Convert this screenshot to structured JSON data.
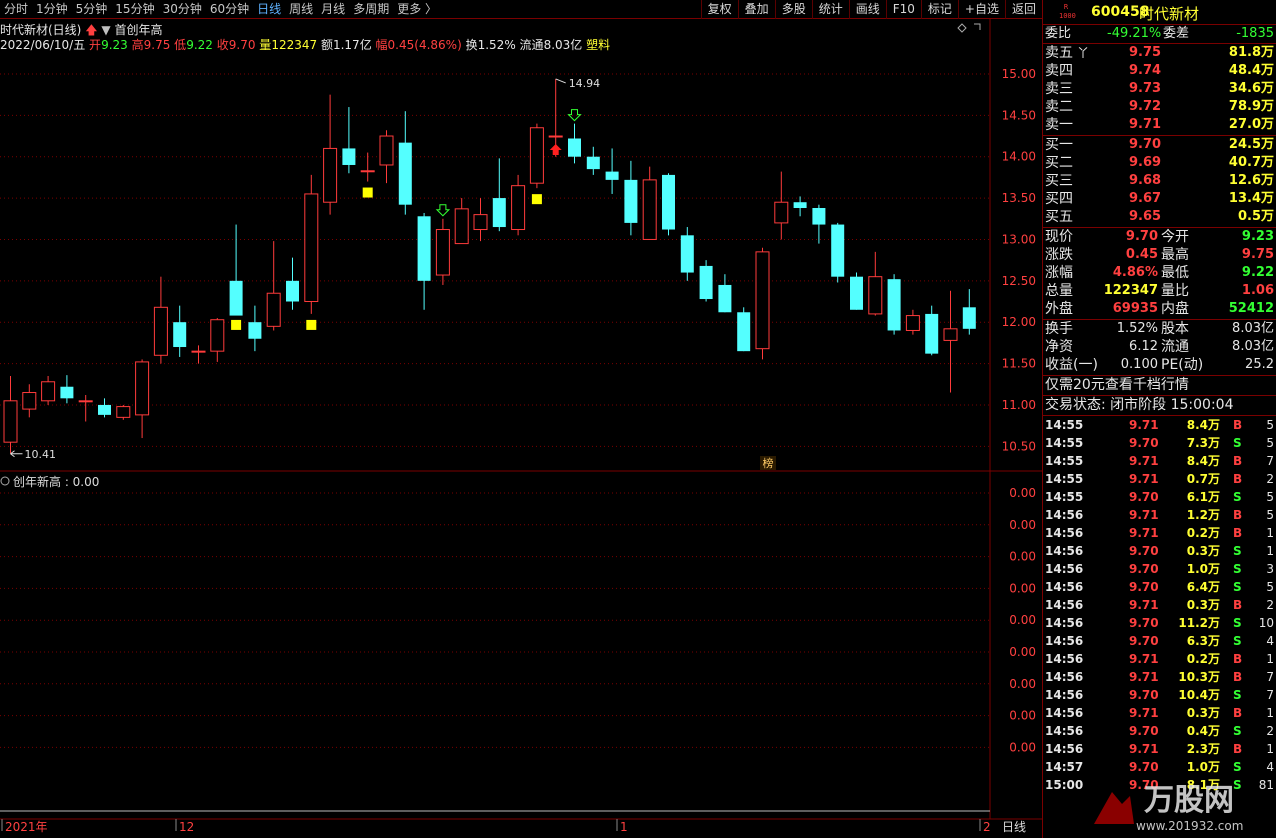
{
  "toolbar": {
    "periods": [
      "分时",
      "1分钟",
      "5分钟",
      "15分钟",
      "30分钟",
      "60分钟",
      "日线",
      "周线",
      "月线",
      "多周期",
      "更多 〉"
    ],
    "active_period": "日线",
    "tools": [
      "复权",
      "叠加",
      "多股",
      "统计",
      "画线",
      "F10",
      "标记",
      "+自选",
      "返回"
    ]
  },
  "chart_header": {
    "title": "时代新材(日线)",
    "indicator": "首创年高",
    "date": "2022/06/10/五",
    "open_label": "开",
    "open": "9.23",
    "high_label": "高",
    "high": "9.75",
    "low_label": "低",
    "low": "9.22",
    "close_label": "收",
    "close": "9.70",
    "volume_label": "量",
    "volume": "122347",
    "amount_label": "额",
    "amount": "1.17亿",
    "range_label": "幅",
    "range": "0.45(4.86%)",
    "turnover_label": "换",
    "turnover": "1.52%",
    "float_label": "流通",
    "float": "8.03亿",
    "sector": "塑料"
  },
  "sub_chart": {
    "title": "创年新高 : 0.00",
    "ticks": [
      "0.00",
      "0.00",
      "0.00",
      "0.00",
      "0.00",
      "0.00",
      "0.00",
      "0.00",
      "0.00"
    ]
  },
  "bottom_axis": {
    "labels": [
      "2021年",
      "12",
      "1",
      "2"
    ],
    "period_label": "日线"
  },
  "badge": "榜",
  "chart_data": {
    "type": "candlestick",
    "y_ticks": [
      "15.00",
      "14.50",
      "14.00",
      "13.50",
      "13.00",
      "12.50",
      "12.00",
      "11.50",
      "11.00",
      "10.50"
    ],
    "ylim": [
      10.25,
      15.35
    ],
    "max_label": "14.94",
    "min_label": "10.41",
    "candles": [
      {
        "o": 10.55,
        "h": 11.35,
        "l": 10.41,
        "c": 11.05
      },
      {
        "o": 10.95,
        "h": 11.25,
        "l": 10.85,
        "c": 11.15
      },
      {
        "o": 11.05,
        "h": 11.35,
        "l": 11.0,
        "c": 11.28
      },
      {
        "o": 11.22,
        "h": 11.36,
        "l": 11.02,
        "c": 11.08
      },
      {
        "o": 11.05,
        "h": 11.12,
        "l": 10.8,
        "c": 11.05
      },
      {
        "o": 11.0,
        "h": 11.08,
        "l": 10.85,
        "c": 10.88
      },
      {
        "o": 10.85,
        "h": 11.0,
        "l": 10.82,
        "c": 10.98
      },
      {
        "o": 10.88,
        "h": 11.55,
        "l": 10.6,
        "c": 11.52
      },
      {
        "o": 11.6,
        "h": 12.55,
        "l": 11.5,
        "c": 12.18
      },
      {
        "o": 12.0,
        "h": 12.2,
        "l": 11.58,
        "c": 11.7
      },
      {
        "o": 11.65,
        "h": 11.72,
        "l": 11.5,
        "c": 11.65
      },
      {
        "o": 11.65,
        "h": 12.05,
        "l": 11.52,
        "c": 12.03
      },
      {
        "o": 12.5,
        "h": 13.18,
        "l": 12.1,
        "c": 12.08
      },
      {
        "o": 12.0,
        "h": 12.2,
        "l": 11.65,
        "c": 11.8
      },
      {
        "o": 11.95,
        "h": 12.98,
        "l": 11.9,
        "c": 12.35
      },
      {
        "o": 12.5,
        "h": 12.78,
        "l": 12.15,
        "c": 12.25
      },
      {
        "o": 12.25,
        "h": 13.78,
        "l": 12.1,
        "c": 13.55
      },
      {
        "o": 13.45,
        "h": 14.75,
        "l": 13.3,
        "c": 14.1
      },
      {
        "o": 14.1,
        "h": 14.6,
        "l": 13.8,
        "c": 13.9
      },
      {
        "o": 13.83,
        "h": 14.05,
        "l": 13.7,
        "c": 13.83
      },
      {
        "o": 13.9,
        "h": 14.32,
        "l": 13.68,
        "c": 14.25
      },
      {
        "o": 14.17,
        "h": 14.55,
        "l": 13.3,
        "c": 13.42
      },
      {
        "o": 13.28,
        "h": 13.32,
        "l": 12.15,
        "c": 12.5
      },
      {
        "o": 12.57,
        "h": 13.25,
        "l": 12.45,
        "c": 13.12
      },
      {
        "o": 12.95,
        "h": 13.5,
        "l": 12.95,
        "c": 13.37
      },
      {
        "o": 13.12,
        "h": 13.5,
        "l": 12.98,
        "c": 13.3
      },
      {
        "o": 13.5,
        "h": 13.98,
        "l": 13.1,
        "c": 13.15
      },
      {
        "o": 13.12,
        "h": 13.78,
        "l": 13.05,
        "c": 13.65
      },
      {
        "o": 13.68,
        "h": 14.4,
        "l": 13.62,
        "c": 14.35
      },
      {
        "o": 14.25,
        "h": 14.94,
        "l": 14.0,
        "c": 14.25
      },
      {
        "o": 14.22,
        "h": 14.4,
        "l": 13.92,
        "c": 14.0
      },
      {
        "o": 14.0,
        "h": 14.12,
        "l": 13.78,
        "c": 13.85
      },
      {
        "o": 13.82,
        "h": 14.1,
        "l": 13.55,
        "c": 13.72
      },
      {
        "o": 13.72,
        "h": 13.95,
        "l": 13.05,
        "c": 13.2
      },
      {
        "o": 13.0,
        "h": 13.88,
        "l": 13.0,
        "c": 13.72
      },
      {
        "o": 13.78,
        "h": 13.8,
        "l": 13.05,
        "c": 13.12
      },
      {
        "o": 13.05,
        "h": 13.15,
        "l": 12.5,
        "c": 12.6
      },
      {
        "o": 12.68,
        "h": 12.75,
        "l": 12.25,
        "c": 12.28
      },
      {
        "o": 12.45,
        "h": 12.58,
        "l": 12.12,
        "c": 12.12
      },
      {
        "o": 12.12,
        "h": 12.18,
        "l": 11.65,
        "c": 11.65
      },
      {
        "o": 11.68,
        "h": 12.9,
        "l": 11.55,
        "c": 12.85
      },
      {
        "o": 13.2,
        "h": 13.82,
        "l": 13.0,
        "c": 13.45
      },
      {
        "o": 13.45,
        "h": 13.52,
        "l": 13.28,
        "c": 13.38
      },
      {
        "o": 13.38,
        "h": 13.42,
        "l": 12.95,
        "c": 13.18
      },
      {
        "o": 13.18,
        "h": 13.2,
        "l": 12.48,
        "c": 12.55
      },
      {
        "o": 12.55,
        "h": 12.6,
        "l": 12.15,
        "c": 12.15
      },
      {
        "o": 12.1,
        "h": 12.85,
        "l": 12.08,
        "c": 12.55
      },
      {
        "o": 12.52,
        "h": 12.58,
        "l": 11.85,
        "c": 11.9
      },
      {
        "o": 11.9,
        "h": 12.15,
        "l": 11.85,
        "c": 12.08
      },
      {
        "o": 12.1,
        "h": 12.2,
        "l": 11.6,
        "c": 11.62
      },
      {
        "o": 11.78,
        "h": 12.38,
        "l": 11.15,
        "c": 11.92
      },
      {
        "o": 12.18,
        "h": 12.4,
        "l": 11.85,
        "c": 11.92
      }
    ],
    "yellow_markers": [
      12,
      16,
      19,
      28
    ],
    "down_arrows": [
      23,
      30
    ],
    "up_arrow": 29
  },
  "quote": {
    "code": "600458",
    "name": "时代新材",
    "r_badge": "R",
    "r_badge_num": "1000",
    "wei_bi_label": "委比",
    "wei_bi": "-49.21%",
    "wei_cha_label": "委差",
    "wei_cha": "-1835",
    "sell": [
      {
        "label": "卖五",
        "price": "9.75",
        "vol": "81.8万",
        "mark": "丫"
      },
      {
        "label": "卖四",
        "price": "9.74",
        "vol": "48.4万",
        "mark": ""
      },
      {
        "label": "卖三",
        "price": "9.73",
        "vol": "34.6万",
        "mark": ""
      },
      {
        "label": "卖二",
        "price": "9.72",
        "vol": "78.9万",
        "mark": ""
      },
      {
        "label": "卖一",
        "price": "9.71",
        "vol": "27.0万",
        "mark": ""
      }
    ],
    "buy": [
      {
        "label": "买一",
        "price": "9.70",
        "vol": "24.5万"
      },
      {
        "label": "买二",
        "price": "9.69",
        "vol": "40.7万"
      },
      {
        "label": "买三",
        "price": "9.68",
        "vol": "12.6万"
      },
      {
        "label": "买四",
        "price": "9.67",
        "vol": "13.4万"
      },
      {
        "label": "买五",
        "price": "9.65",
        "vol": "0.5万"
      }
    ],
    "stats": [
      {
        "l1": "现价",
        "v1": "9.70",
        "c1": "red",
        "l2": "今开",
        "v2": "9.23",
        "c2": "green"
      },
      {
        "l1": "涨跌",
        "v1": "0.45",
        "c1": "red",
        "l2": "最高",
        "v2": "9.75",
        "c2": "red"
      },
      {
        "l1": "涨幅",
        "v1": "4.86%",
        "c1": "red",
        "l2": "最低",
        "v2": "9.22",
        "c2": "green"
      },
      {
        "l1": "总量",
        "v1": "122347",
        "c1": "yellow",
        "l2": "量比",
        "v2": "1.06",
        "c2": "red"
      },
      {
        "l1": "外盘",
        "v1": "69935",
        "c1": "red",
        "l2": "内盘",
        "v2": "52412",
        "c2": "green"
      }
    ],
    "stats2": [
      {
        "l1": "换手",
        "v1": "1.52%",
        "l2": "股本",
        "v2": "8.03亿"
      },
      {
        "l1": "净资",
        "v1": "6.12",
        "l2": "流通",
        "v2": "8.03亿"
      },
      {
        "l1": "收益(一)",
        "v1": "0.100",
        "l2": "PE(动)",
        "v2": "25.2"
      }
    ],
    "promo": "仅需20元查看千档行情",
    "trade_status": "交易状态: 闭市阶段 15:00:04"
  },
  "ticks": [
    {
      "t": "14:55",
      "p": "9.71",
      "v": "8.4万",
      "d": "B",
      "n": "5"
    },
    {
      "t": "14:55",
      "p": "9.70",
      "v": "7.3万",
      "d": "S",
      "n": "5"
    },
    {
      "t": "14:55",
      "p": "9.71",
      "v": "8.4万",
      "d": "B",
      "n": "7"
    },
    {
      "t": "14:55",
      "p": "9.71",
      "v": "0.7万",
      "d": "B",
      "n": "2"
    },
    {
      "t": "14:55",
      "p": "9.70",
      "v": "6.1万",
      "d": "S",
      "n": "5"
    },
    {
      "t": "14:56",
      "p": "9.71",
      "v": "1.2万",
      "d": "B",
      "n": "5"
    },
    {
      "t": "14:56",
      "p": "9.71",
      "v": "0.2万",
      "d": "B",
      "n": "1"
    },
    {
      "t": "14:56",
      "p": "9.70",
      "v": "0.3万",
      "d": "S",
      "n": "1"
    },
    {
      "t": "14:56",
      "p": "9.70",
      "v": "1.0万",
      "d": "S",
      "n": "3"
    },
    {
      "t": "14:56",
      "p": "9.70",
      "v": "6.4万",
      "d": "S",
      "n": "5"
    },
    {
      "t": "14:56",
      "p": "9.71",
      "v": "0.3万",
      "d": "B",
      "n": "2"
    },
    {
      "t": "14:56",
      "p": "9.70",
      "v": "11.2万",
      "d": "S",
      "n": "10"
    },
    {
      "t": "14:56",
      "p": "9.70",
      "v": "6.3万",
      "d": "S",
      "n": "4"
    },
    {
      "t": "14:56",
      "p": "9.71",
      "v": "0.2万",
      "d": "B",
      "n": "1"
    },
    {
      "t": "14:56",
      "p": "9.71",
      "v": "10.3万",
      "d": "B",
      "n": "7"
    },
    {
      "t": "14:56",
      "p": "9.70",
      "v": "10.4万",
      "d": "S",
      "n": "7"
    },
    {
      "t": "14:56",
      "p": "9.71",
      "v": "0.3万",
      "d": "B",
      "n": "1"
    },
    {
      "t": "14:56",
      "p": "9.70",
      "v": "0.4万",
      "d": "S",
      "n": "2"
    },
    {
      "t": "14:56",
      "p": "9.71",
      "v": "2.3万",
      "d": "B",
      "n": "1"
    },
    {
      "t": "14:57",
      "p": "9.70",
      "v": "1.0万",
      "d": "S",
      "n": "4"
    },
    {
      "t": "15:00",
      "p": "9.70",
      "v": "8.1万",
      "d": "S",
      "n": "81"
    }
  ],
  "watermark": {
    "brand": "万股网",
    "site": "www.201932.com"
  },
  "colors": {
    "up": "#ff3b3b",
    "down": "#54ffff",
    "grid": "#7a0000",
    "marker": "#ffff00"
  }
}
